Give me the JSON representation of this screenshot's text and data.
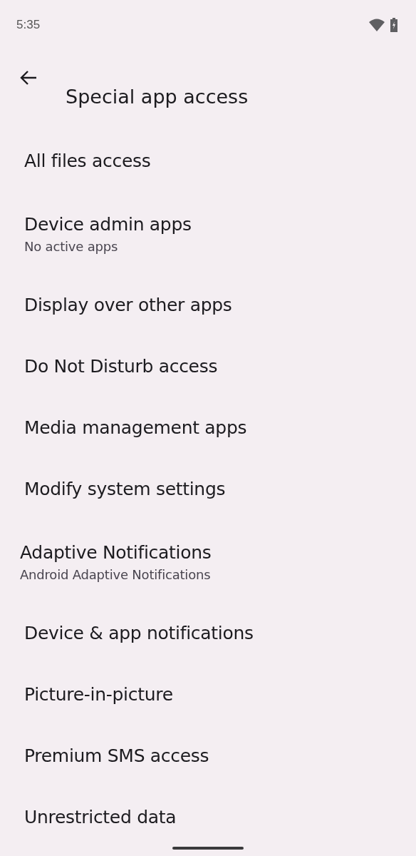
{
  "status_bar": {
    "time": "5:35"
  },
  "title": "Special app access",
  "items": [
    {
      "kind": "standard",
      "title": "All files access"
    },
    {
      "kind": "standard",
      "title": "Device admin apps",
      "summary": "No active apps"
    },
    {
      "kind": "standard",
      "title": "Display over other apps"
    },
    {
      "kind": "standard",
      "title": "Do Not Disturb access"
    },
    {
      "kind": "standard",
      "title": "Media management apps"
    },
    {
      "kind": "standard",
      "title": "Modify system settings"
    },
    {
      "kind": "compact",
      "title": "Adaptive Notifications",
      "summary": "Android Adaptive Notifications"
    },
    {
      "kind": "standard",
      "title": "Device & app notifications"
    },
    {
      "kind": "standard",
      "title": "Picture-in-picture"
    },
    {
      "kind": "standard",
      "title": "Premium SMS access"
    },
    {
      "kind": "standard",
      "title": "Unrestricted data"
    }
  ]
}
